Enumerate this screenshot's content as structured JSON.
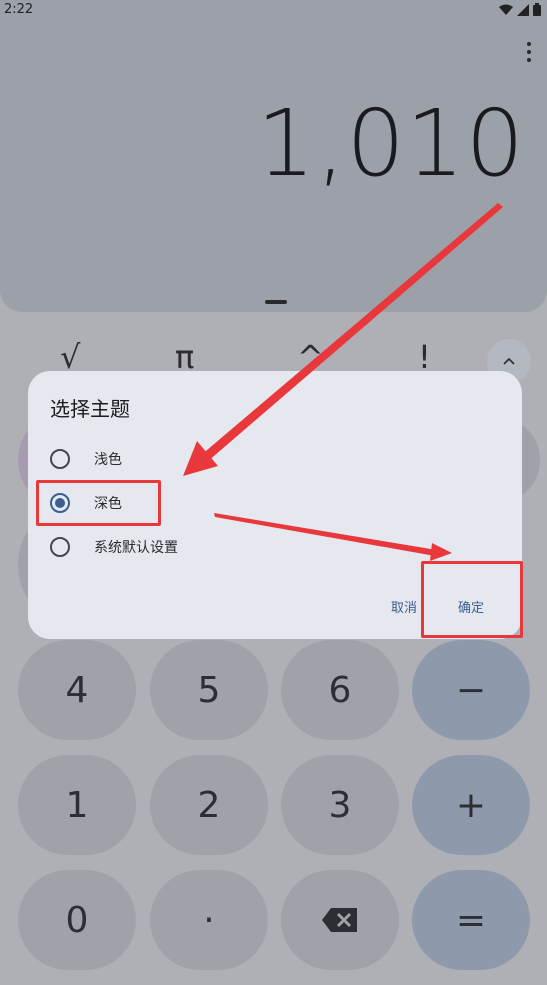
{
  "status": {
    "time": "2:22"
  },
  "display": {
    "value": "1,010"
  },
  "scientific": {
    "sqrt": "√",
    "pi": "π",
    "power": "^",
    "factorial": "!"
  },
  "keypad": {
    "row1": [
      "4",
      "5",
      "6",
      "−"
    ],
    "row2": [
      "1",
      "2",
      "3",
      "+"
    ],
    "row3": [
      "0",
      "·",
      "⌫",
      "="
    ]
  },
  "dialog": {
    "title": "选择主题",
    "options": [
      {
        "label": "浅色",
        "selected": false
      },
      {
        "label": "深色",
        "selected": true
      },
      {
        "label": "系统默认设置",
        "selected": false
      }
    ],
    "cancel_label": "取消",
    "confirm_label": "确定"
  },
  "colors": {
    "dialog_accent": "#3b5f8f",
    "annotation": "#e8383c"
  }
}
